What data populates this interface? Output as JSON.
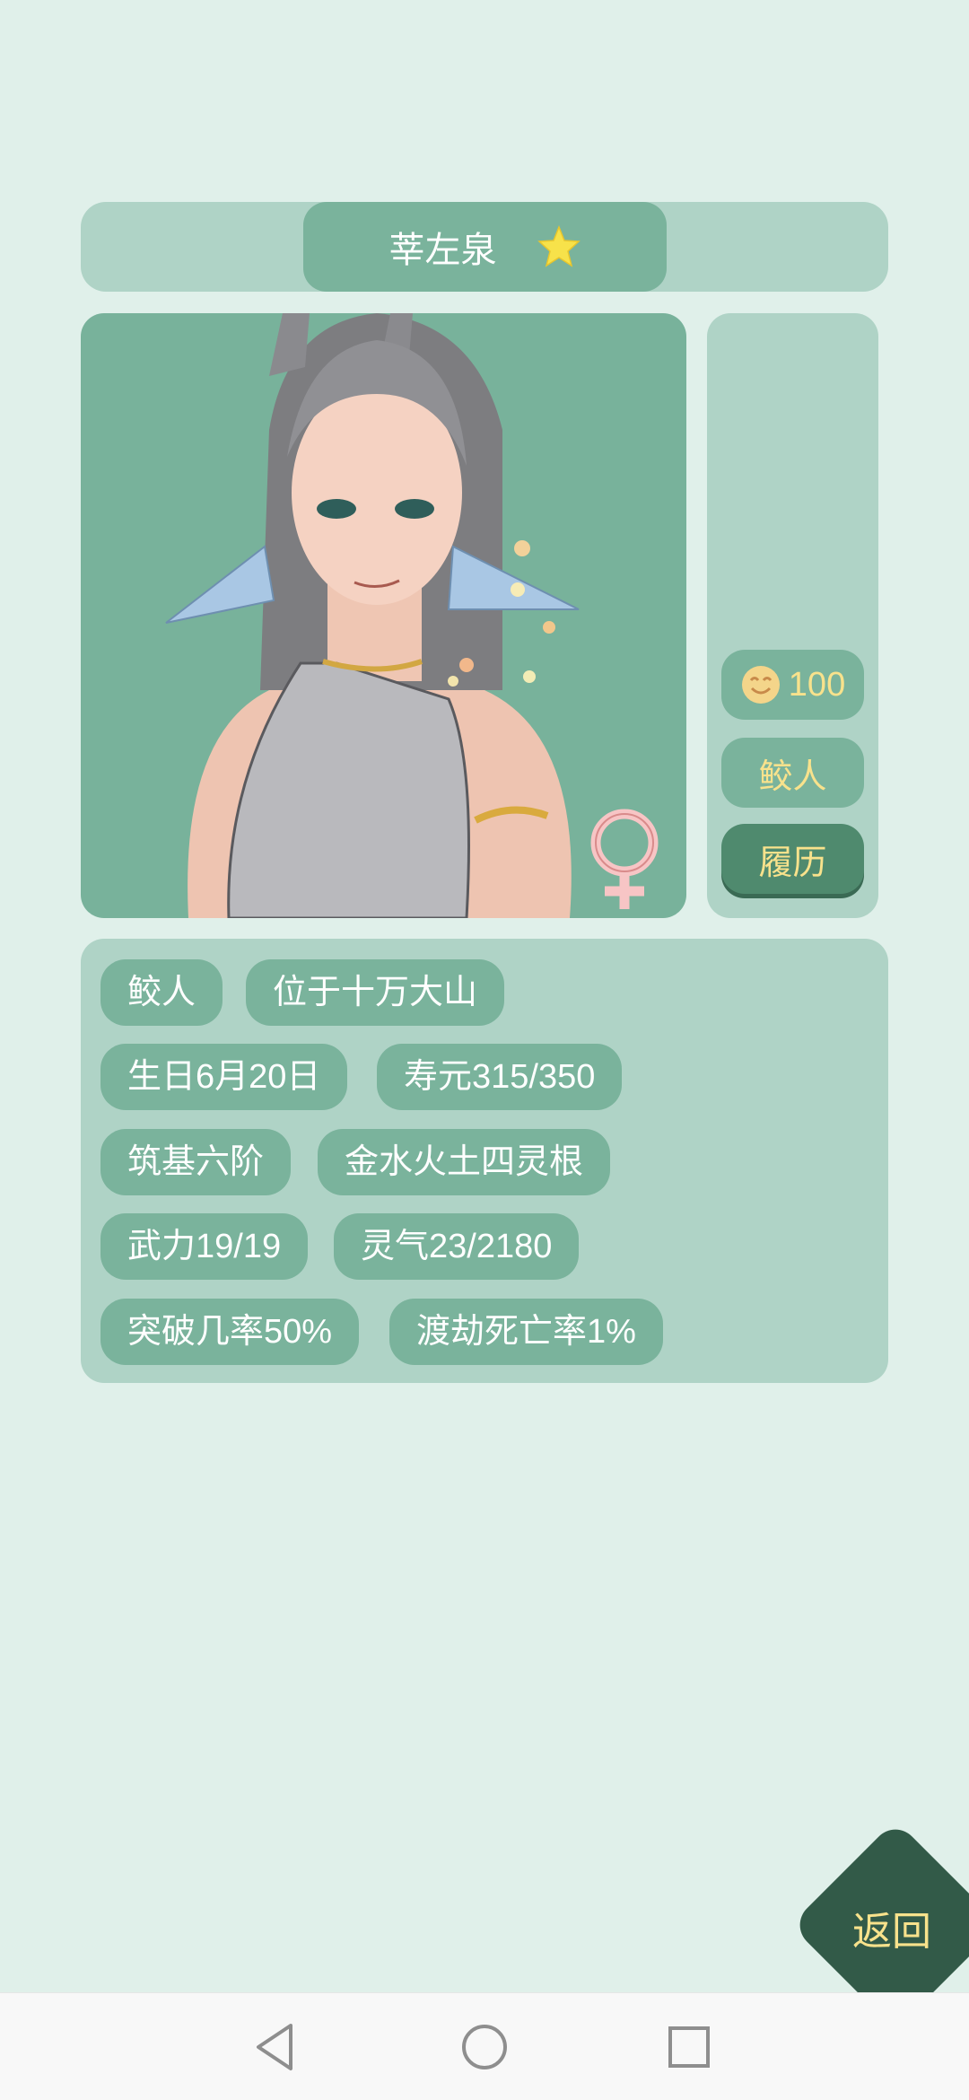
{
  "header": {
    "name": "莘左泉",
    "star_icon": "star-icon"
  },
  "portrait": {
    "gender_symbol": "♀",
    "icon": "female-symbol-icon"
  },
  "side": {
    "mood_icon": "smile-face-icon",
    "mood_value": "100",
    "race": "鲛人",
    "resume_label": "履历"
  },
  "tags": [
    "鲛人",
    "位于十万大山",
    "生日6月20日",
    "寿元315/350",
    "筑基六阶",
    "金水火土四灵根",
    "武力19/19",
    "灵气23/2180",
    "突破几率50%",
    "渡劫死亡率1%"
  ],
  "back_button": {
    "label": "返回"
  },
  "nav": {
    "back_icon": "nav-back-icon",
    "home_icon": "nav-home-icon",
    "recents_icon": "nav-recents-icon"
  },
  "colors": {
    "background": "#e0f0ea",
    "panel": "#afd3c6",
    "pill": "#7ab39c",
    "accent_text": "#f8e28c",
    "back_button": "#325a48"
  }
}
